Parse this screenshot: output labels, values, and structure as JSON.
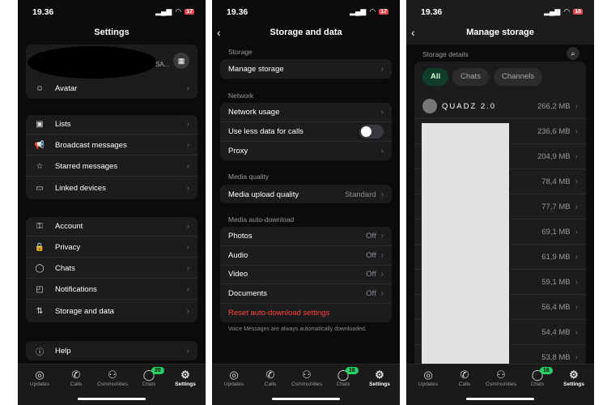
{
  "status": {
    "time": "19.36",
    "battery_1": "17",
    "battery_2": "17",
    "battery_3": "16"
  },
  "settings": {
    "title": "Settings",
    "profile_suffix": "SA...",
    "avatar": "Avatar",
    "group1": [
      "Lists",
      "Broadcast messages",
      "Starred messages",
      "Linked devices"
    ],
    "group2": [
      "Account",
      "Privacy",
      "Chats",
      "Notifications",
      "Storage and data"
    ],
    "help": "Help"
  },
  "storage": {
    "title": "Storage and data",
    "sec_storage": "Storage",
    "manage": "Manage storage",
    "sec_network": "Network",
    "network_usage": "Network usage",
    "less_data": "Use less data for calls",
    "less_data_on": false,
    "proxy": "Proxy",
    "sec_media": "Media quality",
    "upload": "Media upload quality",
    "upload_value": "Standard",
    "sec_auto": "Media auto-download",
    "auto": [
      {
        "label": "Photos",
        "value": "Off"
      },
      {
        "label": "Audio",
        "value": "Off"
      },
      {
        "label": "Video",
        "value": "Off"
      },
      {
        "label": "Documents",
        "value": "Off"
      }
    ],
    "reset": "Reset auto-download settings",
    "footer": "Voice Messages are always automatically downloaded."
  },
  "manage": {
    "title": "Manage storage",
    "details": "Storage details",
    "chips": [
      "All",
      "Chats",
      "Channels"
    ],
    "rows": [
      {
        "name": "QUADZ 2.0",
        "size": "266,2 MB"
      },
      {
        "name": "",
        "size": "236,6 MB"
      },
      {
        "name": "",
        "size": "204,9 MB"
      },
      {
        "name": "",
        "size": "78,4 MB"
      },
      {
        "name": "",
        "size": "77,7 MB"
      },
      {
        "name": "",
        "size": "69,1 MB"
      },
      {
        "name": "",
        "size": "61,9 MB"
      },
      {
        "name": "",
        "size": "59,1 MB"
      },
      {
        "name": "",
        "size": "56,4 MB"
      },
      {
        "name": "",
        "size": "54,4 MB"
      },
      {
        "name": "",
        "size": "53,8 MB"
      }
    ]
  },
  "tabs": [
    {
      "label": "Updates",
      "icon": "updates-icon"
    },
    {
      "label": "Calls",
      "icon": "phone-icon"
    },
    {
      "label": "Communities",
      "icon": "communities-icon"
    },
    {
      "label": "Chats",
      "icon": "chat-icon"
    },
    {
      "label": "Settings",
      "icon": "gear-icon"
    }
  ],
  "chats_badge_1": "20",
  "chats_badge_2": "16",
  "chats_badge_3": "16",
  "colors": {
    "accent": "#25d366",
    "danger": "#ff453a",
    "chip_active": "#103c2a"
  }
}
